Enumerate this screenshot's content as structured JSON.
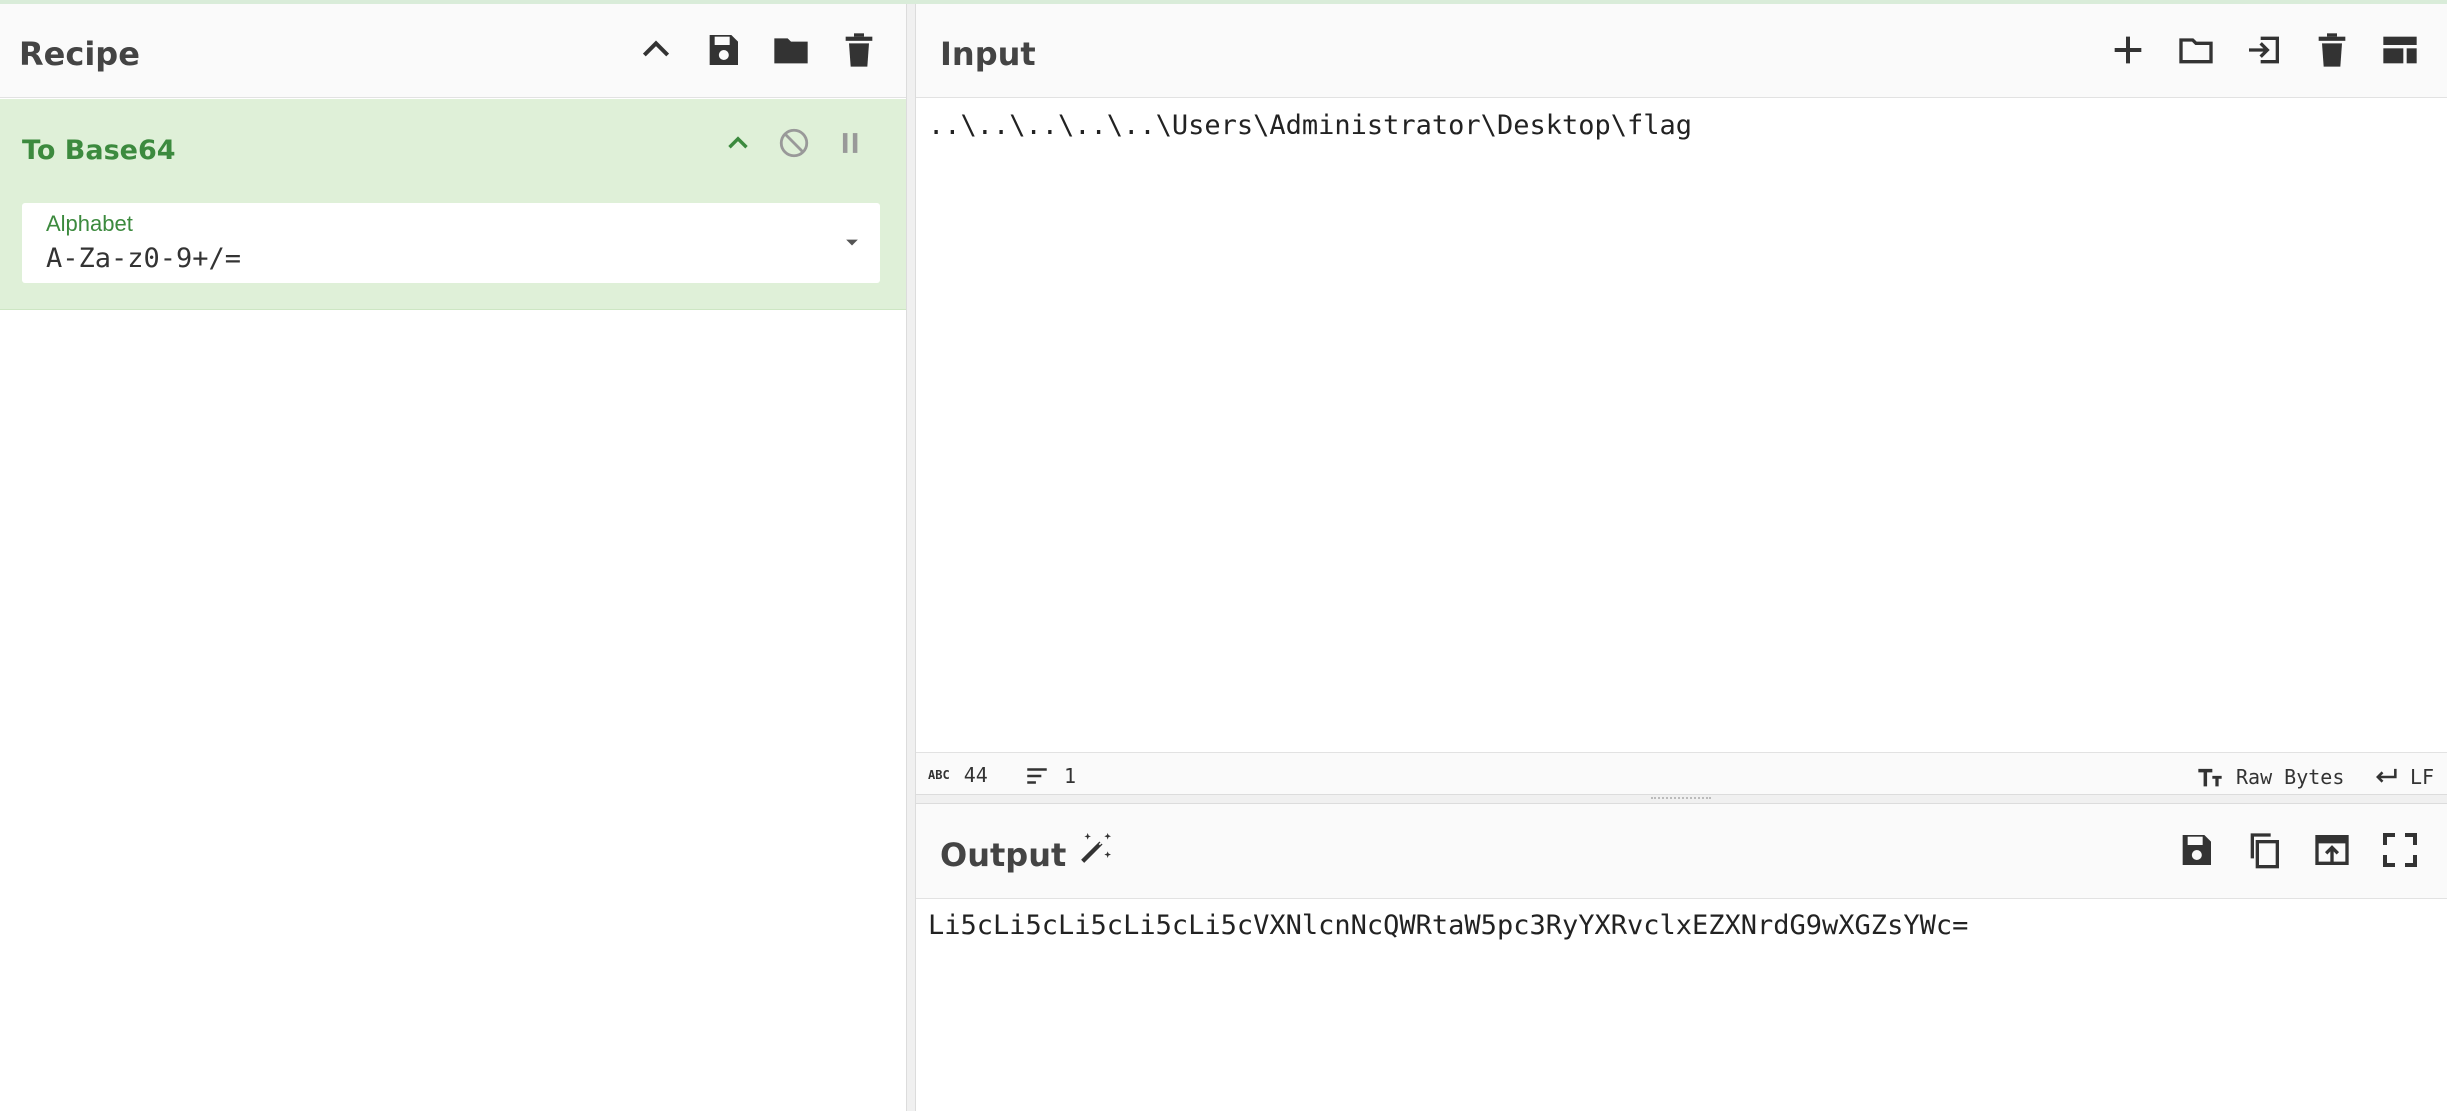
{
  "recipe": {
    "title": "Recipe",
    "operation": {
      "name": "To Base64",
      "arg_label": "Alphabet",
      "arg_value": "A-Za-z0-9+/="
    }
  },
  "input": {
    "title": "Input",
    "text": "..\\..\\..\\..\\..\\Users\\Administrator\\Desktop\\flag",
    "status": {
      "abc_label": "ABC",
      "char_count": "44",
      "line_count": "1",
      "encoding": "Raw Bytes",
      "eol": "LF"
    }
  },
  "output": {
    "title": "Output",
    "text": "Li5cLi5cLi5cLi5cLi5cVXNlcnNcQWRtaW5pc3RyYXRvclxEZXNrdG9wXGZsYWc="
  },
  "colors": {
    "accent_green": "#3c8a3e",
    "card_bg": "#dff0d8"
  }
}
